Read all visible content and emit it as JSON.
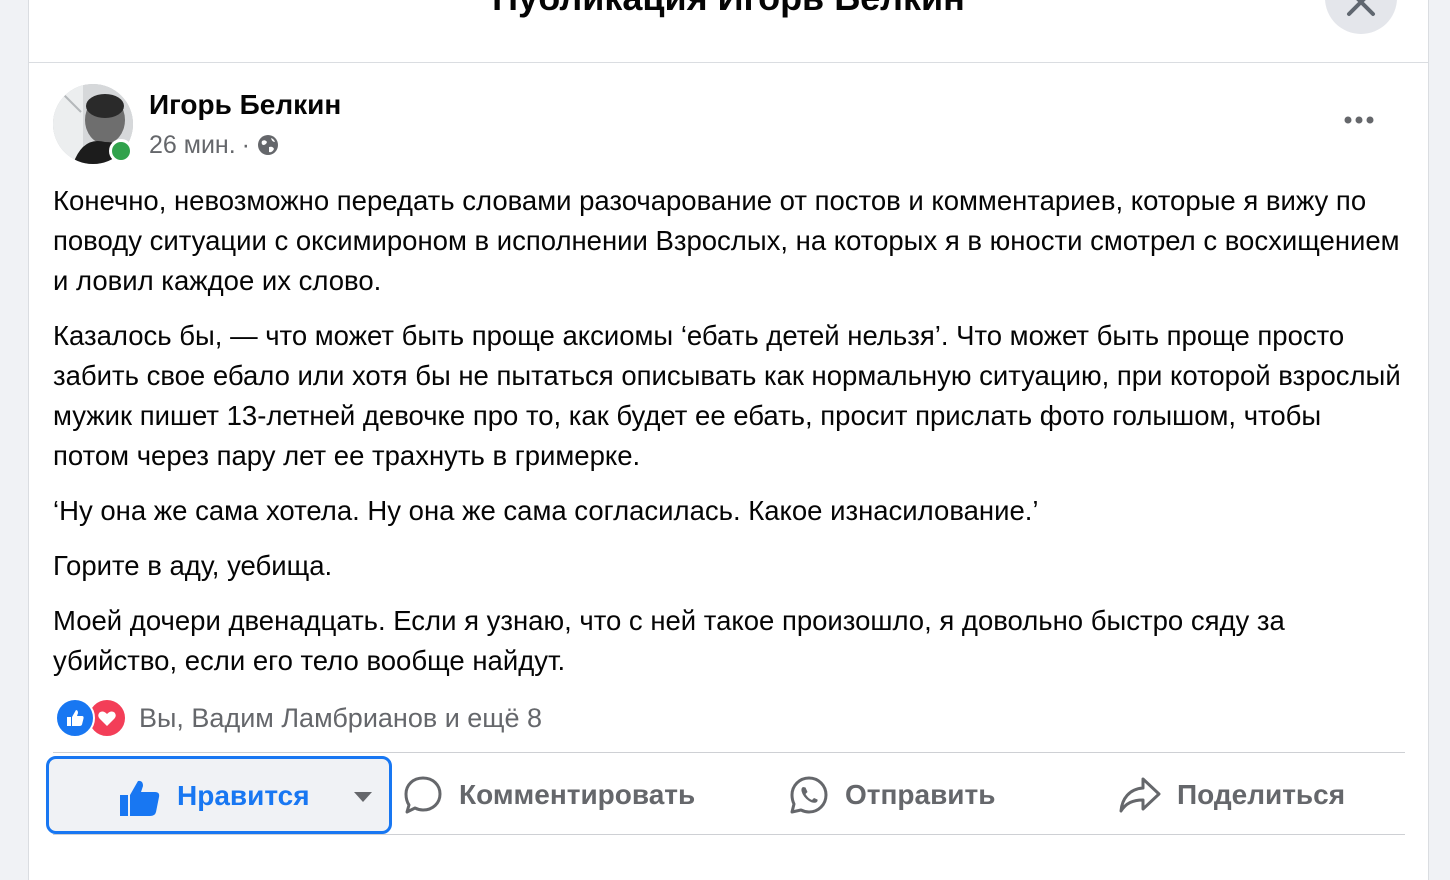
{
  "modal": {
    "title": "Публикация Игорь Белкин"
  },
  "post": {
    "author": "Игорь Белкин",
    "time": "26 мин.",
    "separator": "·",
    "paragraphs": [
      "Конечно, невозможно передать словами разочарование от постов и комментариев, которые я вижу по поводу ситуации с оксимироном в исполнении Взрослых, на которых я в юности смотрел с восхищением и ловил каждое их слово.",
      "Казалось бы, — что может быть проще аксиомы ‘ебать детей нельзя’. Что может быть проще просто забить свое ебало или хотя бы не пытаться описывать как нормальную ситуацию, при которой взрослый мужик пишет 13-летней девочке про то, как будет ее ебать, просит прислать фото голышом, чтобы потом через пару лет ее трахнуть в гримерке.",
      "‘Ну она же сама хотела. Ну она же сама согласилась. Какое изнасилование.’",
      "Горите в аду, уебища.",
      "Моей дочери двенадцать. Если я узнаю, что с ней такое произошло, я довольно быстро сяду за убийство, если его тело вообще найдут."
    ],
    "reactions_text": "Вы, Вадим Ламбрианов и ещё 8"
  },
  "actions": {
    "like": "Нравится",
    "comment": "Комментировать",
    "send": "Отправить",
    "share": "Поделиться"
  },
  "colors": {
    "accent": "#1877f2",
    "secondary_text": "#65676b",
    "online": "#31a24c",
    "love": "#f33e58"
  }
}
